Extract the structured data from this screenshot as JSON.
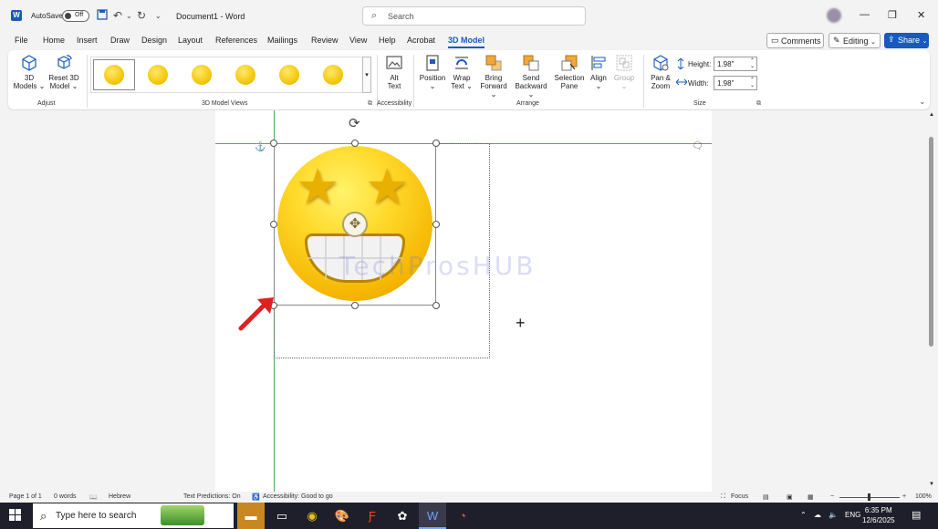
{
  "titlebar": {
    "autosave_label": "AutoSave",
    "autosave_state": "Off",
    "document_title": "Document1  -  Word",
    "search_placeholder": "Search"
  },
  "tabs": [
    "File",
    "Home",
    "Insert",
    "Draw",
    "Design",
    "Layout",
    "References",
    "Mailings",
    "Review",
    "View",
    "Help",
    "Acrobat",
    "3D Model"
  ],
  "active_tab": "3D Model",
  "header_buttons": {
    "comments": "Comments",
    "editing": "Editing",
    "share": "Share"
  },
  "ribbon": {
    "adjust": {
      "models_top": "3D",
      "models_bottom": "Models",
      "reset_top": "Reset 3D",
      "reset_bottom": "Model",
      "group": "Adjust"
    },
    "views": {
      "group": "3D Model Views"
    },
    "accessibility": {
      "alt_top": "Alt",
      "alt_bottom": "Text",
      "group": "Accessibility"
    },
    "arrange": {
      "position_top": "Position",
      "wrap_top": "Wrap",
      "wrap_bottom": "Text",
      "bring_top": "Bring",
      "bring_bottom": "Forward",
      "send_top": "Send",
      "send_bottom": "Backward",
      "selection_top": "Selection",
      "selection_bottom": "Pane",
      "align": "Align",
      "group_btn": "Group",
      "group": "Arrange"
    },
    "size": {
      "pan_top": "Pan &",
      "pan_bottom": "Zoom",
      "height_label": "Height:",
      "height_value": "1.98\"",
      "width_label": "Width:",
      "width_value": "1.98\"",
      "group": "Size"
    }
  },
  "document": {
    "watermark": "TechProsHUB"
  },
  "statusbar": {
    "page": "Page 1 of 1",
    "words": "0 words",
    "language": "Hebrew",
    "predictions": "Text Predictions: On",
    "accessibility": "Accessibility: Good to go",
    "focus": "Focus",
    "zoom": "100%"
  },
  "taskbar": {
    "search_text": "Type here to search",
    "lang": "ENG",
    "time": "6:35 PM",
    "date": "12/6/2025"
  },
  "colors": {
    "accent": "#185abd",
    "guide": "#4caf50",
    "arrow": "#e02020"
  }
}
